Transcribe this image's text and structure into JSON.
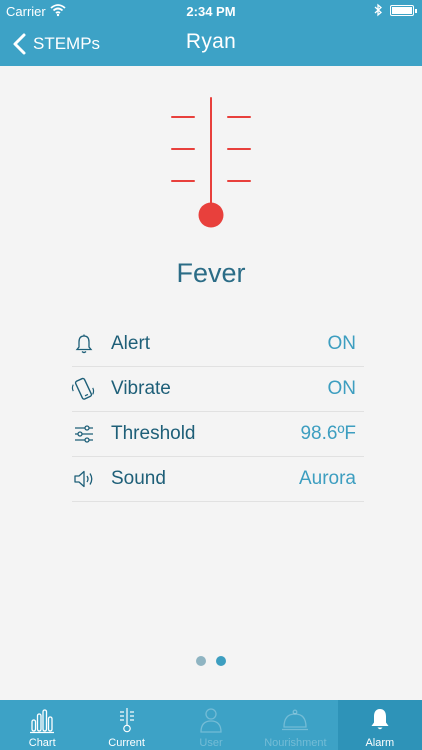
{
  "status_bar": {
    "carrier": "Carrier",
    "time": "2:34 PM"
  },
  "nav": {
    "back_label": "STEMPs",
    "title": "Ryan"
  },
  "status": {
    "label": "Fever"
  },
  "settings": [
    {
      "icon": "bell-icon",
      "label": "Alert",
      "value": "ON"
    },
    {
      "icon": "vibrate-phone-icon",
      "label": "Vibrate",
      "value": "ON"
    },
    {
      "icon": "sliders-icon",
      "label": "Threshold",
      "value": "98.6ºF"
    },
    {
      "icon": "speaker-icon",
      "label": "Sound",
      "value": "Aurora"
    }
  ],
  "pager": {
    "count": 2,
    "current": 2
  },
  "tabs": [
    {
      "icon": "bar-chart-icon",
      "label": "Chart",
      "state": "normal"
    },
    {
      "icon": "thermometer-icon",
      "label": "Current",
      "state": "normal"
    },
    {
      "icon": "user-icon",
      "label": "User",
      "state": "disabled"
    },
    {
      "icon": "cloche-icon",
      "label": "Nourishment",
      "state": "disabled"
    },
    {
      "icon": "bell-icon",
      "label": "Alarm",
      "state": "active"
    }
  ],
  "colors": {
    "accent": "#3da2c6",
    "fever_red": "#e8403c",
    "text_dark": "#1e5f78",
    "value_blue": "#3d9ec0",
    "dot_inactive": "#8fb4c2",
    "dot_active": "#3d9ec0"
  }
}
